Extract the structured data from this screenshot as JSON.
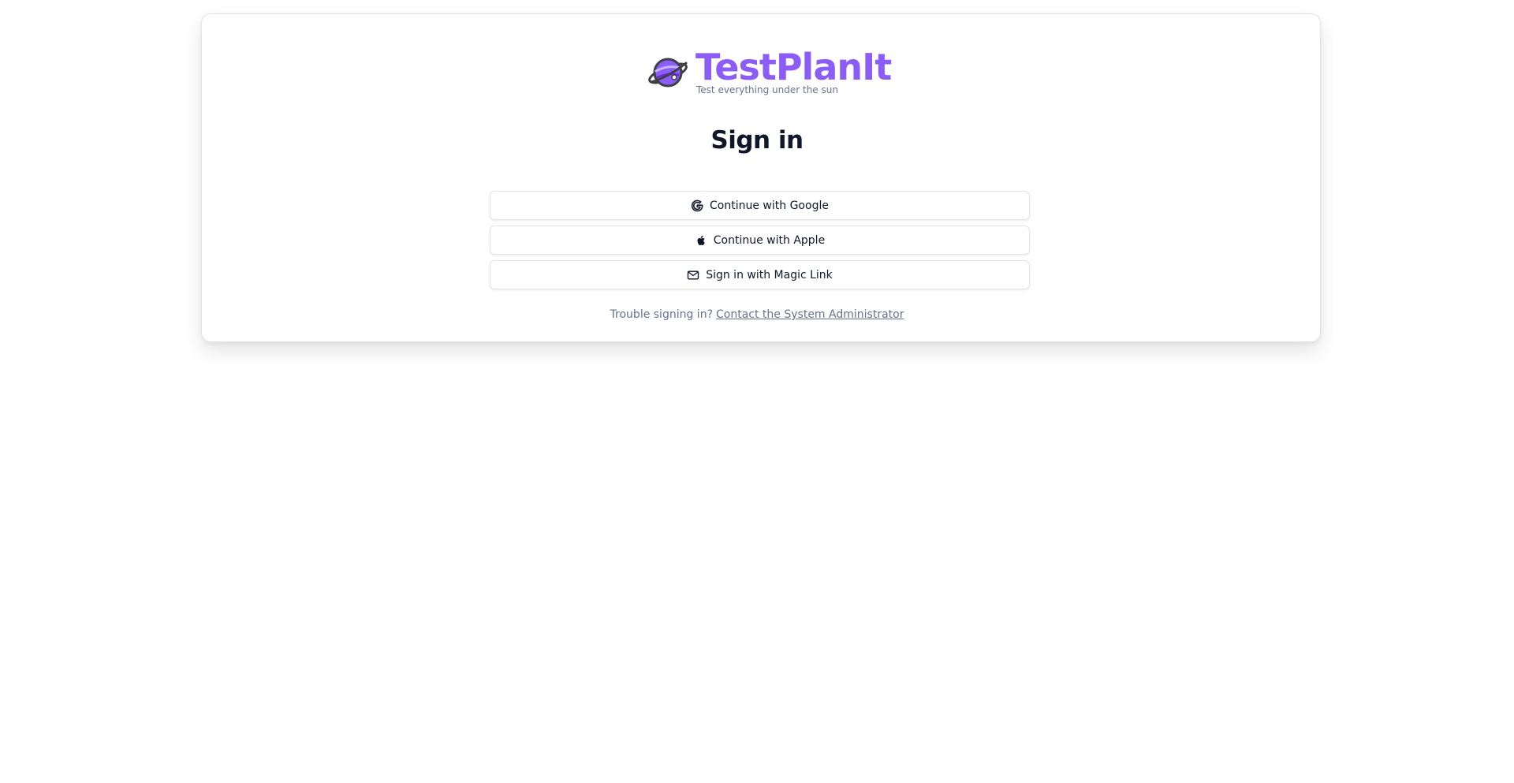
{
  "brand": {
    "name": "TestPlanIt",
    "tagline": "Test everything under the sun",
    "accent_color": "#8b5cf6",
    "logo_icon": "planet-icon"
  },
  "signin": {
    "title": "Sign in",
    "providers": [
      {
        "label": "Continue with Google",
        "icon": "google-icon"
      },
      {
        "label": "Continue with Apple",
        "icon": "apple-icon"
      },
      {
        "label": "Sign in with Magic Link",
        "icon": "mail-icon"
      }
    ]
  },
  "help": {
    "prompt": "Trouble signing in?",
    "link_label": "Contact the System Administrator"
  }
}
